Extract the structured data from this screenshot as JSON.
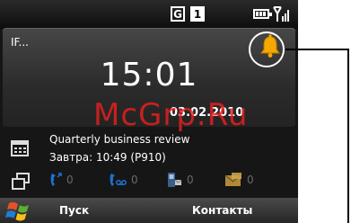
{
  "status_bar": {
    "network_badge": "G",
    "sim_badge": "1",
    "icons": [
      "network-g-icon",
      "sim-1-icon",
      "battery-icon",
      "signal-icon"
    ]
  },
  "clock": {
    "operator": "IF...",
    "time": "15:01",
    "date": "03.02.2010",
    "alarm_icon": "alarm-bell-icon",
    "alarm_color": "#f5a800"
  },
  "watermark": "McGrp.Ru",
  "appointment": {
    "title": "Quarterly business review",
    "time": "Завтра: 10:49 (P910)",
    "icon": "calendar-icon"
  },
  "notifications": [
    {
      "icon": "missed-call-icon",
      "count": "0"
    },
    {
      "icon": "voicemail-icon",
      "count": "0"
    },
    {
      "icon": "sms-icon",
      "count": "0"
    },
    {
      "icon": "email-icon",
      "count": "0"
    }
  ],
  "softkeys": {
    "left": "Пуск",
    "right": "Контакты",
    "start_icon": "windows-flag-icon"
  },
  "colors": {
    "accent_blue": "#1e6fd0",
    "alarm": "#f5a800",
    "dim_count": "#6a6a6a"
  }
}
